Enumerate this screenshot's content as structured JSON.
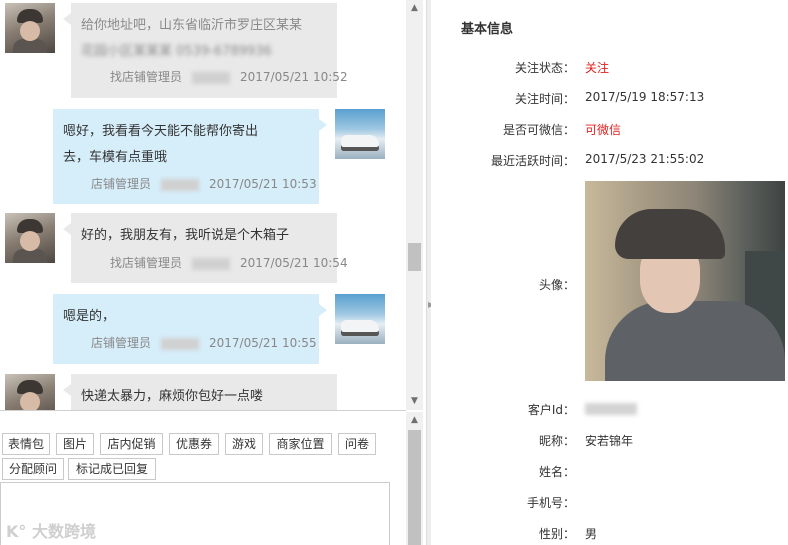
{
  "chat": {
    "messages": [
      {
        "direction": "in",
        "text_line1": "给你地址吧，山东省临沂市罗庄区某某",
        "text_line2": "花园小区某某某 0539-6789936",
        "sender": "找店铺管理员",
        "time": "2017/05/21 10:52"
      },
      {
        "direction": "out",
        "text_line1": "嗯好，我看看今天能不能帮你寄出",
        "text_line2": "去，车模有点重哦",
        "sender": "店铺管理员",
        "time": "2017/05/21 10:53"
      },
      {
        "direction": "in",
        "text_line1": "好的，我朋友有，我听说是个木箱子",
        "sender": "找店铺管理员",
        "time": "2017/05/21 10:54"
      },
      {
        "direction": "out",
        "text_line1": "嗯是的，",
        "sender": "店铺管理员",
        "time": "2017/05/21 10:55"
      },
      {
        "direction": "in",
        "text_line1": "快递太暴力，麻烦你包好一点喽"
      }
    ]
  },
  "toolbar": {
    "buttons": [
      "表情包",
      "图片",
      "店内促销",
      "优惠券",
      "游戏",
      "商家位置",
      "问卷",
      "分配顾问",
      "标记成已回复"
    ]
  },
  "watermark": "大数跨境",
  "info": {
    "title": "基本信息",
    "follow_status_label": "关注状态：",
    "follow_status_value": "关注",
    "follow_time_label": "关注时间：",
    "follow_time_value": "2017/5/19 18:57:13",
    "wechat_label": "是否可微信：",
    "wechat_value": "可微信",
    "last_active_label": "最近活跃时间：",
    "last_active_value": "2017/5/23 21:55:02",
    "avatar_label": "头像：",
    "customer_id_label": "客户Id：",
    "nickname_label": "昵称：",
    "nickname_value": "安若锦年",
    "name_label": "姓名：",
    "phone_label": "手机号：",
    "gender_label": "性别：",
    "gender_value": "男"
  },
  "colors": {
    "accent_red": "#e02020",
    "bubble_in": "#e9e9e9",
    "bubble_out": "#d6eefa"
  }
}
